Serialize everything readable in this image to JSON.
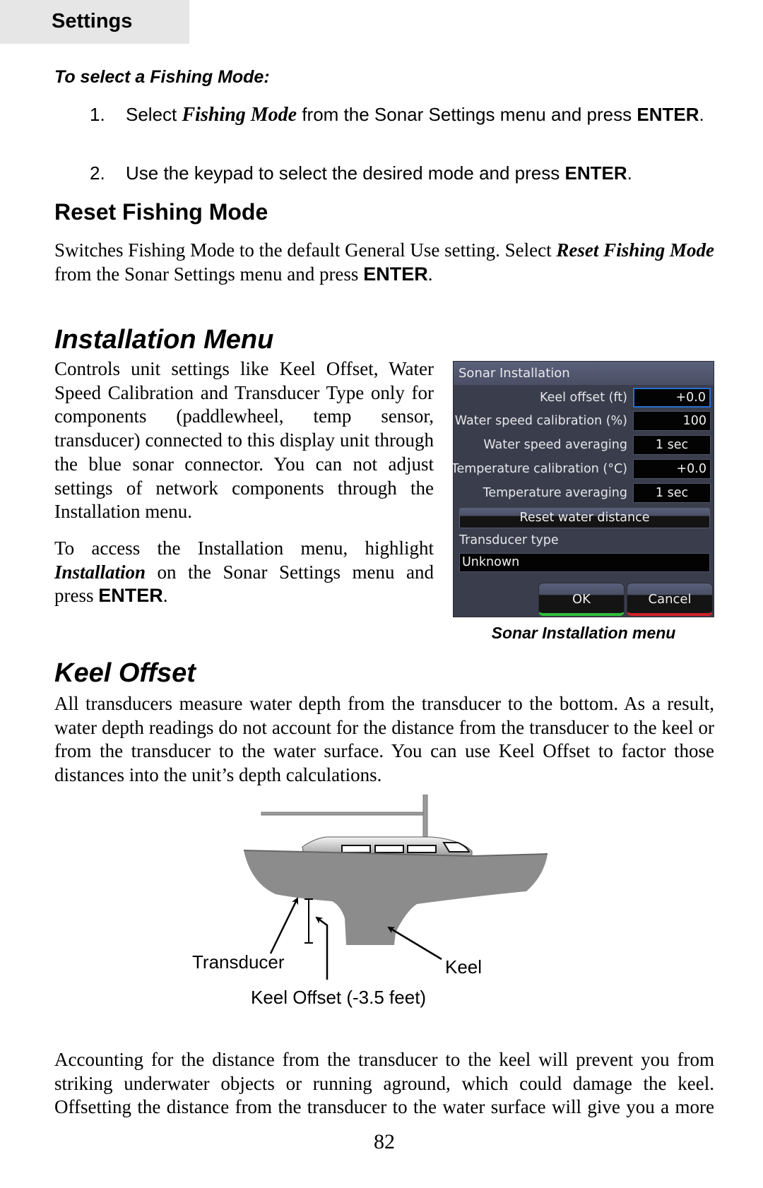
{
  "header": {
    "section_tab": "Settings"
  },
  "fishing_mode": {
    "procedure_title": "To select a Fishing Mode:",
    "steps": [
      {
        "number": "1.",
        "pre": "Select ",
        "emph": "Fishing Mode",
        "post": " from the Sonar Settings menu and press ",
        "key": "ENTER",
        "end": "."
      },
      {
        "number": "2.",
        "pre": "Use the keypad to select the desired mode and press ",
        "key": "ENTER",
        "end": "."
      }
    ]
  },
  "reset_fishing_mode": {
    "title": "Reset Fishing Mode",
    "body_pre": "Switches Fishing Mode to the default General Use setting. Select ",
    "body_emph": "Reset Fishing Mode",
    "body_mid": " from the Sonar Settings menu and press ",
    "body_key": "ENTER",
    "body_end": "."
  },
  "installation_menu": {
    "title": "Installation Menu",
    "paragraph1": "Controls unit settings like Keel Offset, Water Speed Calibration and Transducer Type only for components (paddlewheel, temp sensor, transducer) connected to this display unit through the blue sonar connector.  You can not adjust settings of network components through the Installation menu.",
    "paragraph2_pre": "To access  the Installation menu, highlight ",
    "paragraph2_emph": "Installation",
    "paragraph2_mid": " on the Sonar Settings menu and press ",
    "paragraph2_key": "ENTER",
    "paragraph2_end": "."
  },
  "sonar_installation_dialog": {
    "title": "Sonar Installation",
    "rows": [
      {
        "label": "Keel offset (ft)",
        "value": "+0.0"
      },
      {
        "label": "Water speed calibration (%)",
        "value": "100"
      },
      {
        "label": "Water speed averaging",
        "value": "1 sec"
      },
      {
        "label": "Temperature calibration (°C)",
        "value": "+0.0"
      },
      {
        "label": "Temperature averaging",
        "value": "1 sec"
      }
    ],
    "reset_button": "Reset water distance",
    "transducer_type_label": "Transducer type",
    "transducer_type_value": "Unknown",
    "ok_button": "OK",
    "cancel_button": "Cancel",
    "colors": {
      "ok_accent": "#2fbf3a",
      "cancel_accent": "#d0202a",
      "focus": "#2a6fd0"
    },
    "caption": "Sonar Installation menu"
  },
  "keel_offset": {
    "title": "Keel Offset",
    "body": "All transducers measure water depth from the transducer to the bottom. As a result, water depth readings do not account for the distance from the transducer to the keel or from the transducer to the water surface. You can use Keel Offset to factor those distances into the unit’s depth calculations.",
    "diagram": {
      "label_transducer": "Transducer",
      "label_keel": "Keel",
      "label_offset": "Keel Offset (-3.5 feet)"
    },
    "body2": "Accounting for the distance from the transducer to the keel will prevent you from striking underwater objects or running aground, which could damage the keel. Offsetting the distance from the transducer to the water surface will give you a more"
  },
  "footer": {
    "page_number": "82"
  }
}
